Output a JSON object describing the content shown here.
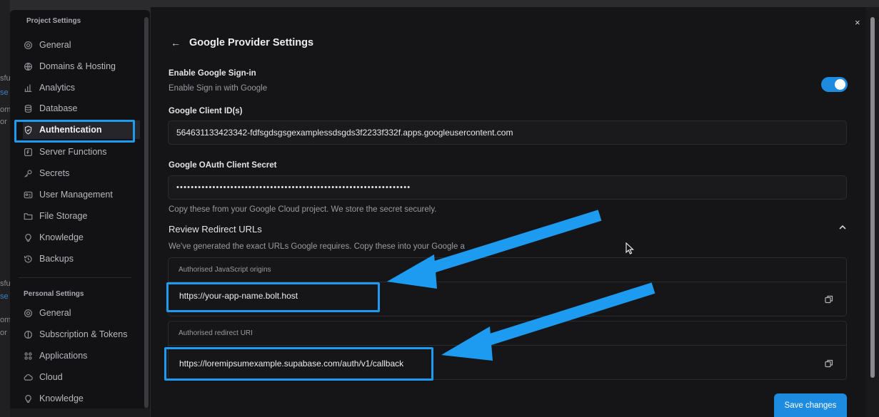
{
  "sidebar": {
    "project_heading": "Project Settings",
    "project_items": [
      {
        "label": "General",
        "icon": "gear-icon"
      },
      {
        "label": "Domains & Hosting",
        "icon": "globe-icon"
      },
      {
        "label": "Analytics",
        "icon": "bar-chart-icon"
      },
      {
        "label": "Database",
        "icon": "database-icon"
      },
      {
        "label": "Authentication",
        "icon": "shield-icon"
      },
      {
        "label": "Server Functions",
        "icon": "function-icon"
      },
      {
        "label": "Secrets",
        "icon": "key-icon"
      },
      {
        "label": "User Management",
        "icon": "users-icon"
      },
      {
        "label": "File Storage",
        "icon": "folder-icon"
      },
      {
        "label": "Knowledge",
        "icon": "lightbulb-icon"
      },
      {
        "label": "Backups",
        "icon": "history-icon"
      }
    ],
    "personal_heading": "Personal Settings",
    "personal_items": [
      {
        "label": "General",
        "icon": "gear-icon"
      },
      {
        "label": "Subscription & Tokens",
        "icon": "coin-icon"
      },
      {
        "label": "Applications",
        "icon": "apps-icon"
      },
      {
        "label": "Cloud",
        "icon": "cloud-icon"
      },
      {
        "label": "Knowledge",
        "icon": "lightbulb-icon"
      }
    ],
    "active_item": "Authentication"
  },
  "background_text": [
    "sfu",
    "se",
    "om",
    "or",
    "sfu",
    "se",
    "om",
    "or"
  ],
  "panel": {
    "title": "Google Provider Settings",
    "enable_label": "Enable Google Sign-in",
    "enable_sub": "Enable Sign in with Google",
    "enabled": true,
    "client_id_label": "Google Client ID(s)",
    "client_id_value": "564631133423342-fdfsgdsgsgexamplessdsgds3f2233f332f.apps.googleusercontent.com",
    "secret_label": "Google OAuth Client Secret",
    "secret_value": "•••••••••••••••••••••••••••••••••••••••••••••••••••••••••••••••••",
    "secret_help": "Copy these from your Google Cloud project. We store the secret securely.",
    "review_title": "Review Redirect URLs",
    "review_sub": "We've generated the exact URLs Google requires. Copy these into your Google a",
    "origins_label": "Authorised JavaScript origins",
    "origins_value": "https://your-app-name.bolt.host",
    "redirect_label": "Authorised redirect URI",
    "redirect_value": "https://loremipsumexample.supabase.com/auth/v1/callback",
    "save_label": "Save changes",
    "close_glyph": "×",
    "back_glyph": "←"
  },
  "colors": {
    "accent": "#1d8ce0",
    "annotation": "#1d9bf0",
    "background": "#151517"
  }
}
